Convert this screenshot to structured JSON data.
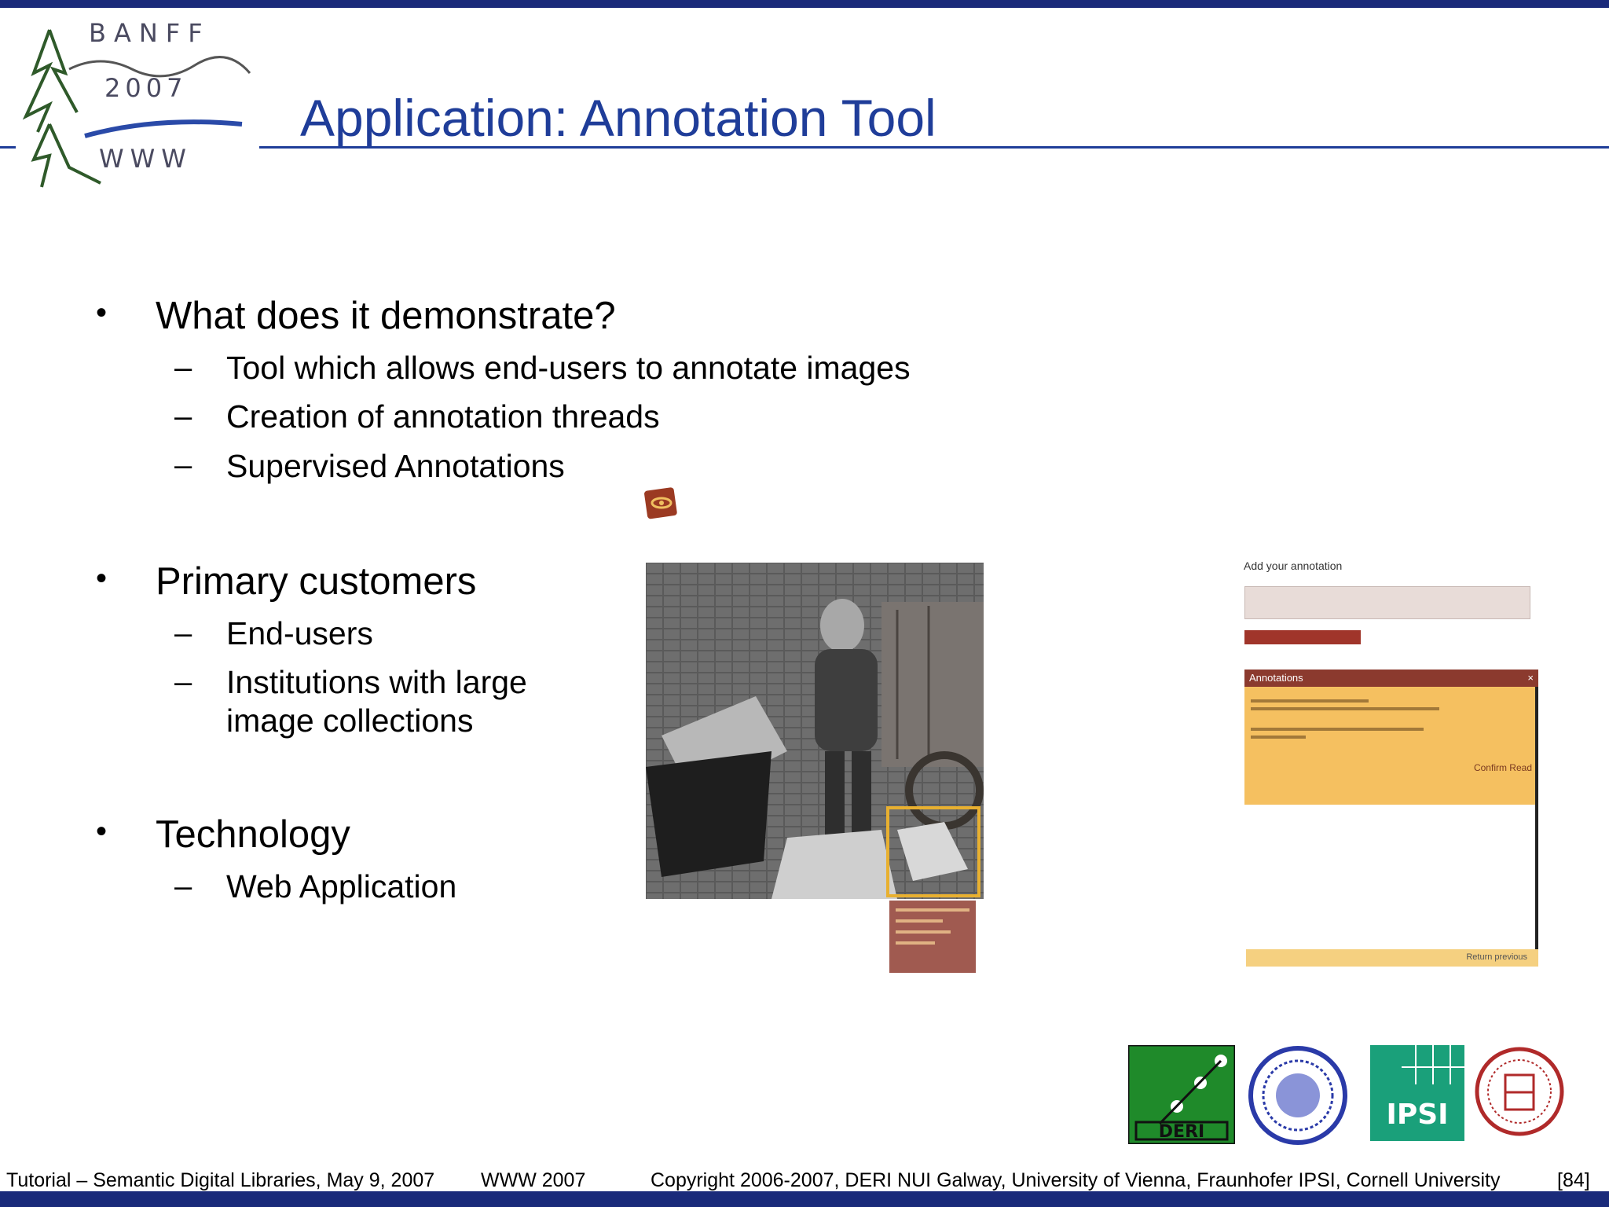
{
  "logo": {
    "line1": "BANFF",
    "line2": "2007",
    "line3": "WWW"
  },
  "title": "Application: Annotation Tool",
  "sections": [
    {
      "heading": "What does it demonstrate?",
      "items": [
        "Tool which allows end-users to annotate images",
        "Creation of annotation threads",
        "Supervised Annotations"
      ]
    },
    {
      "heading": "Primary customers",
      "items": [
        "End-users",
        "Institutions with large",
        "image collections"
      ]
    },
    {
      "heading": "Technology",
      "items": [
        "Web Application"
      ]
    }
  ],
  "panel": {
    "heading": "Add your annotation",
    "header_bar": "Annotations",
    "confirm": "Confirm Read",
    "footer": "Return previous"
  },
  "partners": {
    "deri": "DERI",
    "ipsi": "IPSI"
  },
  "footer": {
    "left": "Tutorial – Semantic Digital Libraries, May 9, 2007",
    "event": "WWW 2007",
    "copyright": "Copyright 2006-2007, DERI NUI Galway, University of Vienna, Fraunhofer IPSI, Cornell University",
    "page": "[84]"
  },
  "colors": {
    "title": "#1f3d99",
    "bars": "#1a2a7a",
    "annotation_bg": "#f5c060",
    "annotation_header": "#8b3a2e"
  }
}
